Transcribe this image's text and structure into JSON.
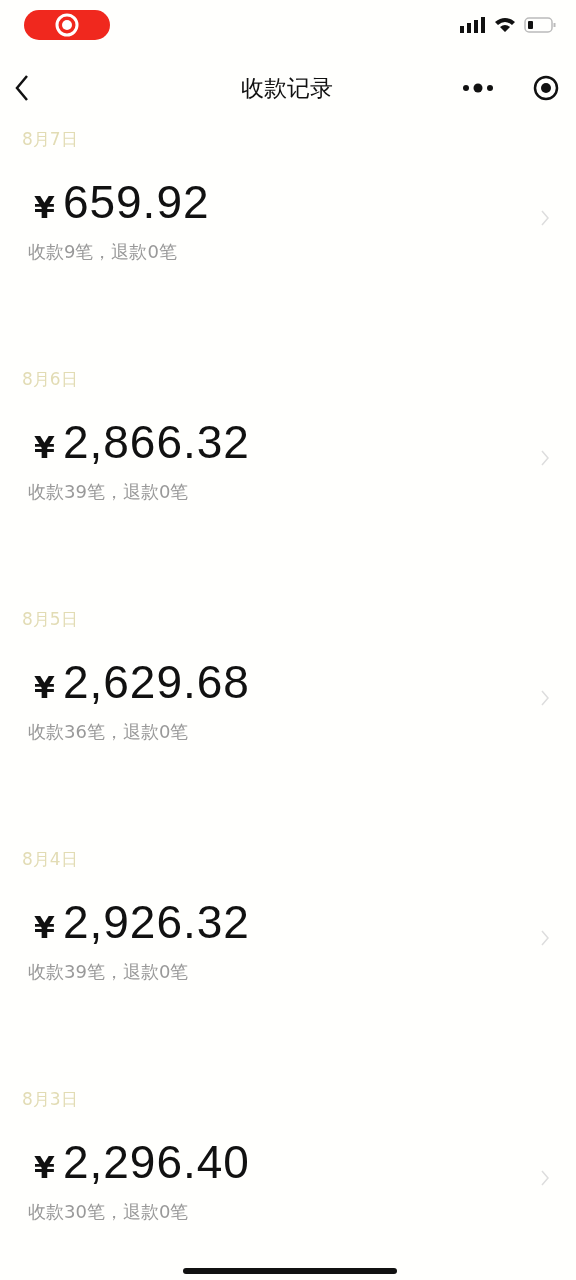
{
  "nav": {
    "title": "收款记录"
  },
  "records": [
    {
      "date": "8月7日",
      "currency": "¥",
      "amount": "659.92",
      "summary": "收款9笔，退款0笔"
    },
    {
      "date": "8月6日",
      "currency": "¥",
      "amount": "2,866.32",
      "summary": "收款39笔，退款0笔"
    },
    {
      "date": "8月5日",
      "currency": "¥",
      "amount": "2,629.68",
      "summary": "收款36笔，退款0笔"
    },
    {
      "date": "8月4日",
      "currency": "¥",
      "amount": "2,926.32",
      "summary": "收款39笔，退款0笔"
    },
    {
      "date": "8月3日",
      "currency": "¥",
      "amount": "2,296.40",
      "summary": "收款30笔，退款0笔"
    }
  ]
}
